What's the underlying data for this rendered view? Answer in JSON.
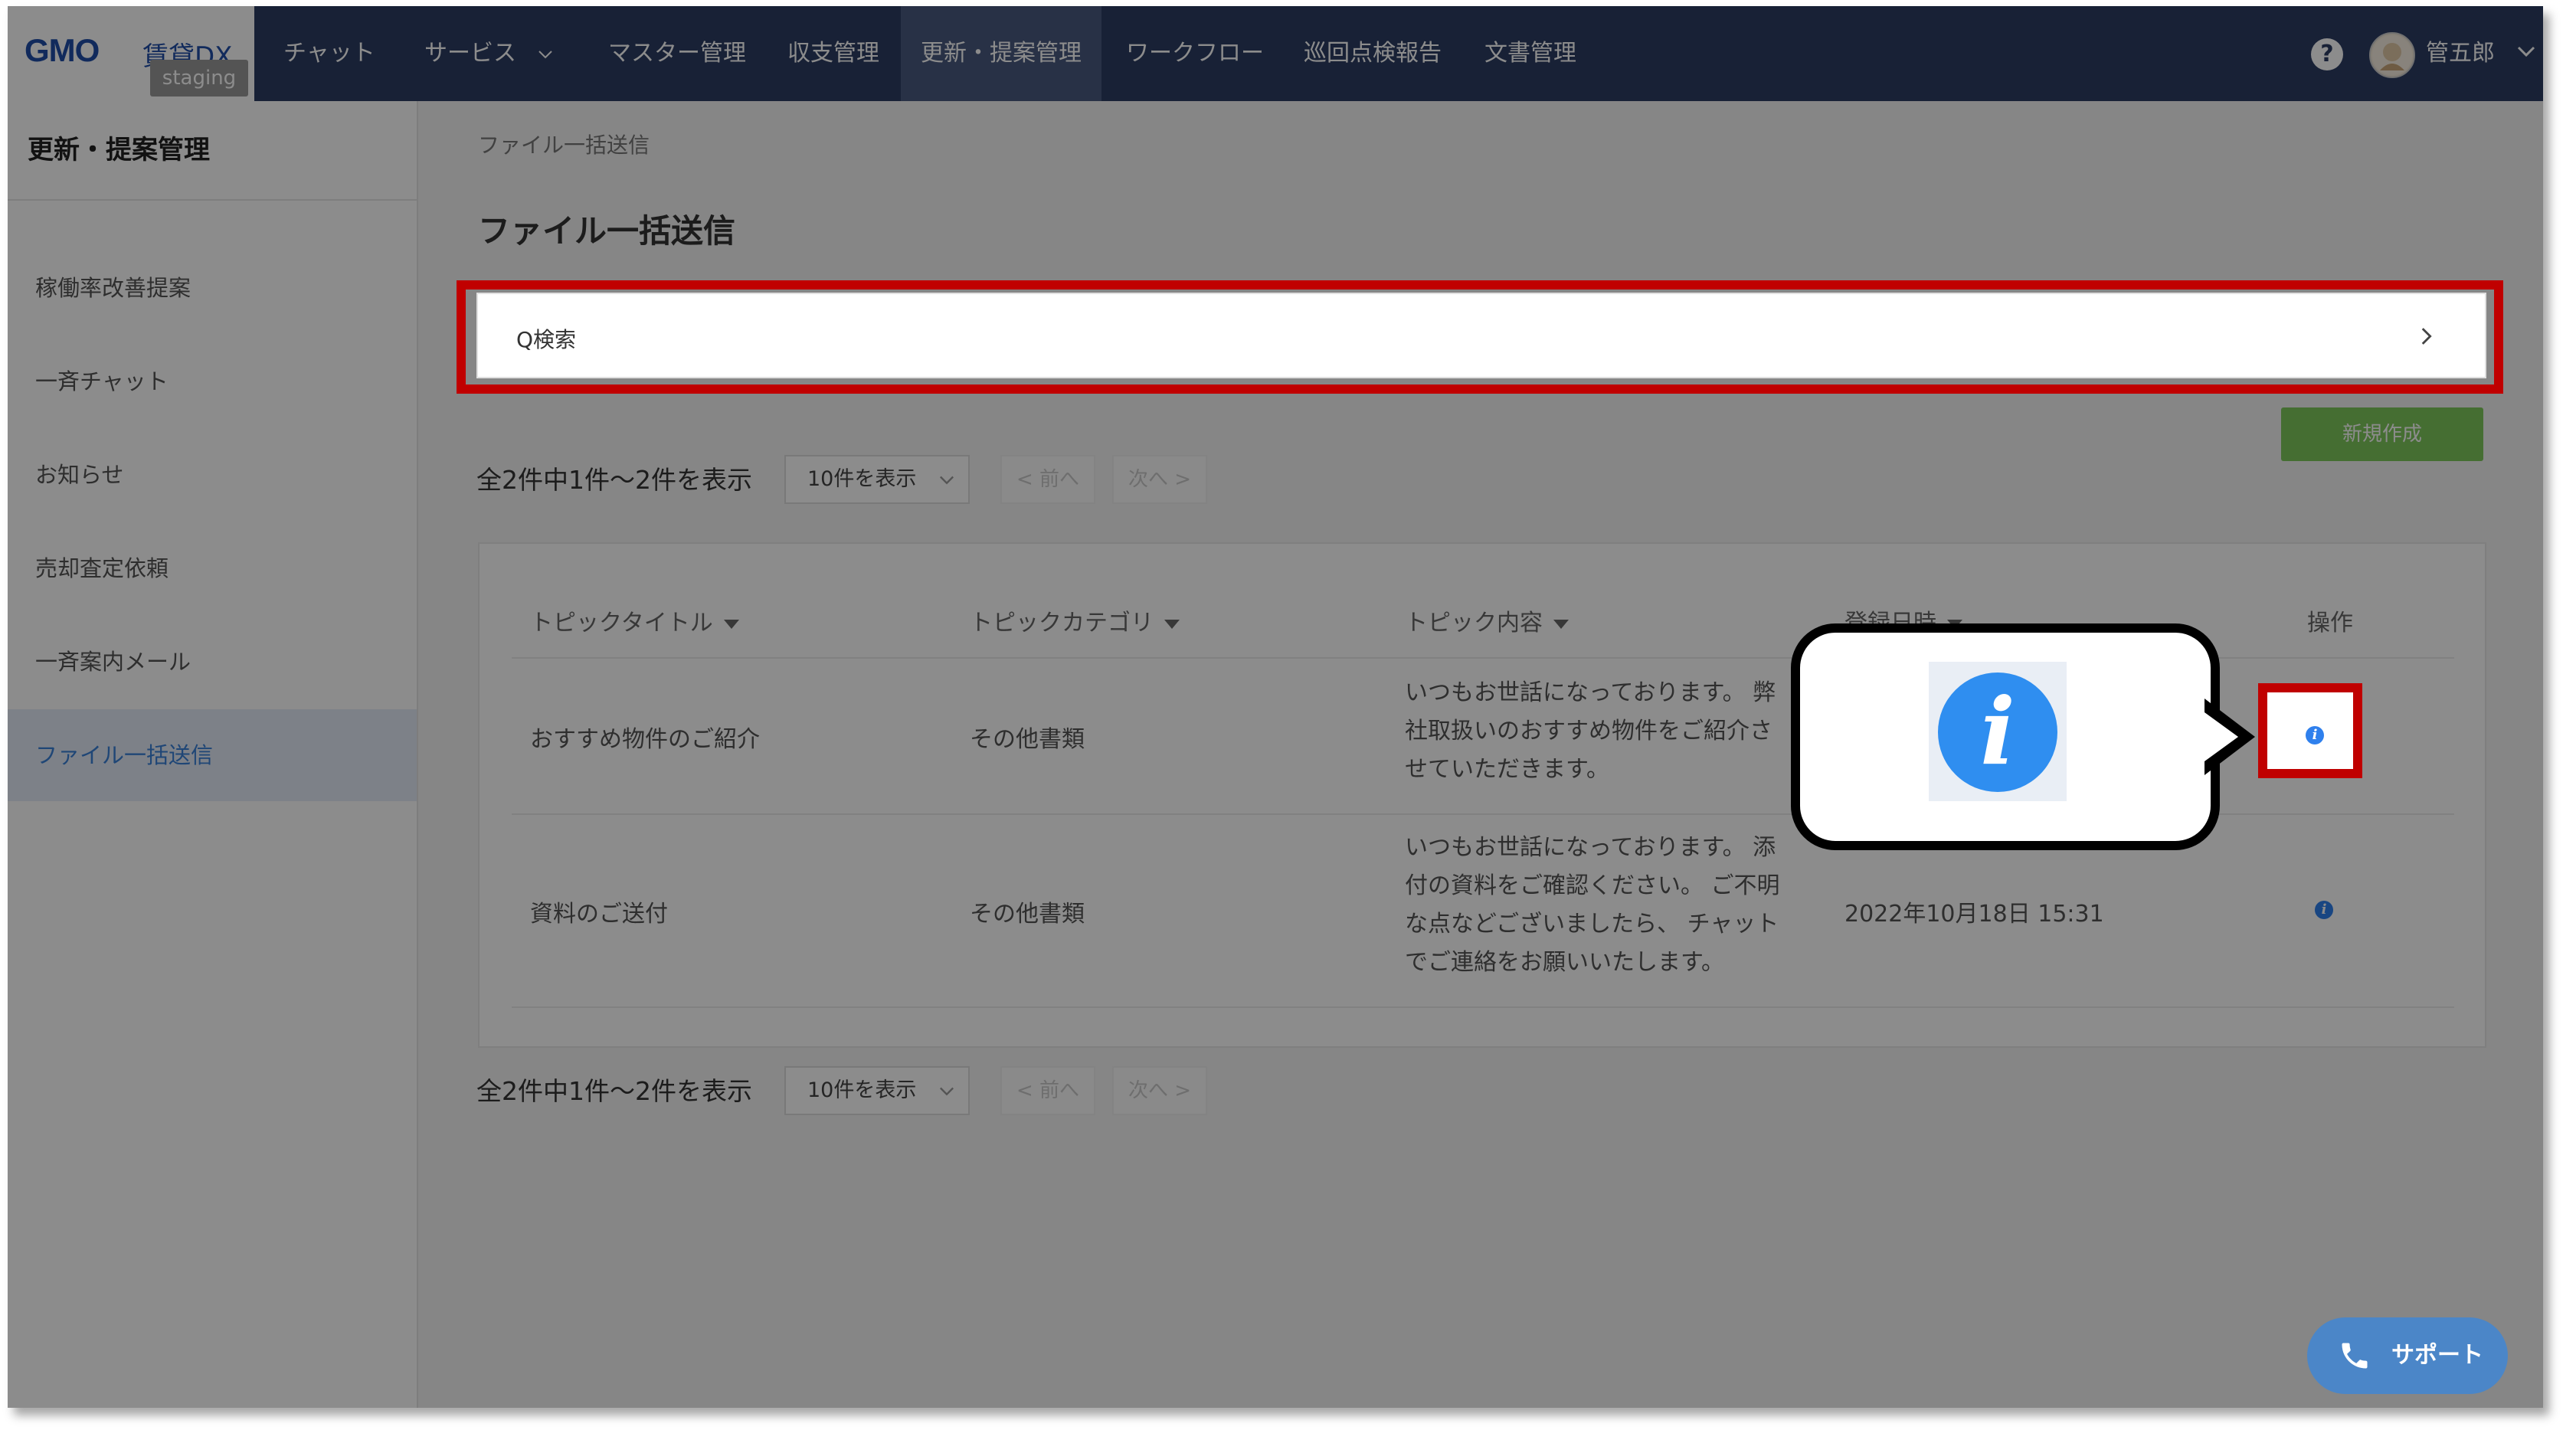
{
  "brand": {
    "logo": "GMO",
    "logo_sub": "賃貸DX",
    "env_badge": "staging"
  },
  "nav": {
    "items": [
      {
        "label": "チャット"
      },
      {
        "label": "サービス"
      },
      {
        "label": "マスター管理"
      },
      {
        "label": "収支管理"
      },
      {
        "label": "更新・提案管理"
      },
      {
        "label": "ワークフロー"
      },
      {
        "label": "巡回点検報告"
      },
      {
        "label": "文書管理"
      }
    ],
    "help": "?",
    "username": "管五郎"
  },
  "sidebar": {
    "title": "更新・提案管理",
    "items": [
      {
        "label": "稼働率改善提案"
      },
      {
        "label": "一斉チャット"
      },
      {
        "label": "お知らせ"
      },
      {
        "label": "売却査定依頼"
      },
      {
        "label": "一斉案内メール"
      },
      {
        "label": "ファイル一括送信"
      }
    ]
  },
  "main": {
    "breadcrumb": "ファイル一括送信",
    "title": "ファイル一括送信",
    "search_label": "Q検索",
    "new_button": "新規作成",
    "pager": {
      "count_text": "全2件中1件～2件を表示",
      "per_page": "10件を表示",
      "prev": "< 前へ",
      "next": "次へ >"
    },
    "table": {
      "headers": [
        "トピックタイトル",
        "トピックカテゴリ",
        "トピック内容",
        "登録日時",
        "操作"
      ],
      "rows": [
        {
          "title": "おすすめ物件のご紹介",
          "category": "その他書類",
          "content": "いつもお世話になっております。 弊社取扱いのおすすめ物件をご紹介させていただきます。",
          "date": ""
        },
        {
          "title": "資料のご送付",
          "category": "その他書類",
          "content": "いつもお世話になっております。 添付の資料をご確認ください。 ご不明な点などございましたら、 チャットでご連絡をお願いいたします。",
          "date": "2022年10月18日 15:31"
        }
      ]
    }
  },
  "info_glyph": "i",
  "support_label": "サポート"
}
